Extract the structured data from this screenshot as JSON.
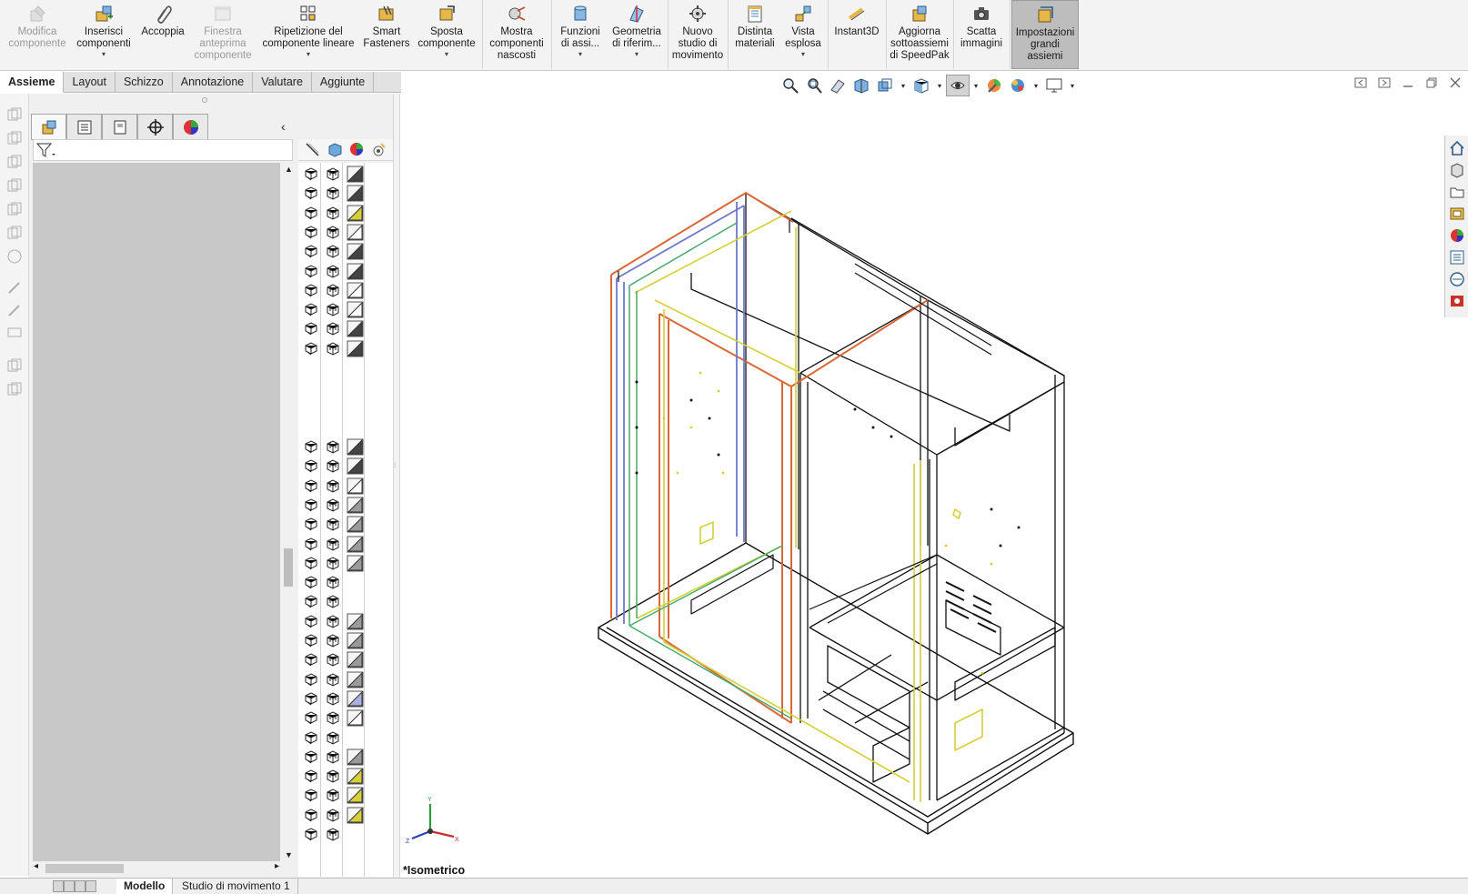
{
  "ribbon": {
    "items": [
      {
        "label": "Modifica\ncomponente",
        "icon": "edit-component-icon",
        "disabled": true
      },
      {
        "label": "Inserisci\ncomponenti",
        "icon": "insert-components-icon",
        "dropdown": true
      },
      {
        "label": "Accoppia",
        "icon": "mate-paperclip-icon"
      },
      {
        "label": "Finestra\nanteprima\ncomponente",
        "icon": "component-preview-icon",
        "disabled": true
      },
      {
        "label": "Ripetizione del\ncomponente lineare",
        "icon": "linear-pattern-icon",
        "dropdown": true
      },
      {
        "label": "Smart\nFasteners",
        "icon": "smart-fasteners-icon"
      },
      {
        "label": "Sposta\ncomponente",
        "icon": "move-component-icon",
        "dropdown": true
      },
      {
        "label": "Mostra\ncomponenti\nnascosti",
        "icon": "show-hidden-icon"
      },
      {
        "label": "Funzioni\ndi assi...",
        "icon": "assembly-features-icon",
        "dropdown": true
      },
      {
        "label": "Geometria\ndi riferim...",
        "icon": "reference-geometry-icon",
        "dropdown": true
      },
      {
        "label": "Nuovo\nstudio di\nmovimento",
        "icon": "motion-study-icon"
      },
      {
        "label": "Distinta\nmateriali",
        "icon": "bill-of-materials-icon"
      },
      {
        "label": "Vista\nesplosa",
        "icon": "exploded-view-icon",
        "dropdown": true
      },
      {
        "label": "Instant3D",
        "icon": "instant3d-icon"
      },
      {
        "label": "Aggiorna\nsottoassiemi\ndi SpeedPak",
        "icon": "speedpak-icon"
      },
      {
        "label": "Scatta\nimmagini",
        "icon": "camera-icon"
      },
      {
        "label": "Impostazioni\ngrandi\nassiemi",
        "icon": "large-assembly-icon",
        "active": true
      }
    ]
  },
  "tabs": [
    "Assieme",
    "Layout",
    "Schizzo",
    "Annotazione",
    "Valutare",
    "Aggiunte"
  ],
  "selected_tab": "Assieme",
  "feature_manager": {
    "tabs": [
      "feature-manager-icon",
      "property-manager-icon",
      "configuration-manager-icon",
      "dimxpert-icon",
      "display-manager-icon"
    ],
    "collapse_glyph": "‹",
    "column_icons": [
      "hide-show-icon",
      "display-mode-icon",
      "appearance-icon",
      "transparency-icon"
    ],
    "row_groups": [
      {
        "count": 10,
        "third": [
          "dark",
          "dark",
          "yellow",
          "light",
          "dark",
          "dark",
          "light",
          "light",
          "dark",
          "dark"
        ]
      },
      {
        "count": 21,
        "third": [
          "dark",
          "dark",
          "light",
          "grey",
          "grey",
          "grey",
          "grey",
          "none",
          "none",
          "grey",
          "grey",
          "grey",
          "grey",
          "blue",
          "light",
          "none",
          "grey",
          "yellow",
          "yellow",
          "yellow",
          "none"
        ]
      }
    ]
  },
  "view": {
    "name": "*Isometrico",
    "triad_labels": {
      "x": "X",
      "y": "Y",
      "z": "Z"
    }
  },
  "bottom_tabs": [
    "Modello",
    "Studio di movimento 1"
  ],
  "selected_bottom_tab": "Modello",
  "colors": {
    "accent_active": "#bdbdbd",
    "model_black": "#111111",
    "model_orange": "#d9683a",
    "model_blue": "#6f78c9",
    "model_yellow": "#d6cf38",
    "model_green": "#48a96a"
  }
}
